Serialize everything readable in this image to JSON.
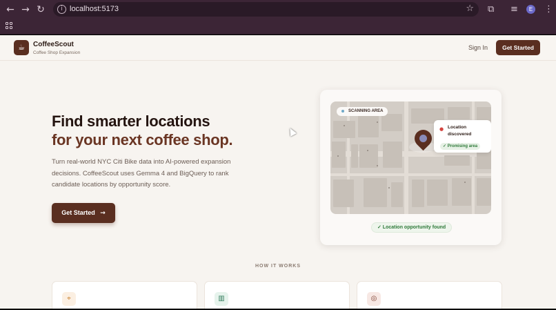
{
  "browser": {
    "url": "localhost:5173",
    "profile_initial": "E",
    "icons": {
      "back": "arrow-left-icon",
      "forward": "arrow-right-icon",
      "reload": "reload-icon",
      "info": "site-info-icon",
      "bookmark": "star-icon",
      "extensions": "puzzle-icon",
      "media": "media-controls-icon",
      "menu": "more-vert-icon",
      "apps": "apps-grid-icon"
    }
  },
  "header": {
    "brand": "CoffeeScout",
    "brand_sub": "Coffee Shop Expansion",
    "sign_in": "Sign In",
    "cta": "Get Started"
  },
  "hero": {
    "title_line1": "Find smarter locations",
    "title_line2": "for your next coffee shop.",
    "lead_lines": [
      "Turn real-world NYC Citi Bike data into AI-powered expansion",
      "decisions. CoffeeScout uses Gemma 4 and BigQuery to rank",
      "candidate locations by opportunity score."
    ],
    "cta": "Get Started",
    "cta_arrow": "→"
  },
  "map_card": {
    "scanning": "SCANNING AREA",
    "popup_title": "Location discovered",
    "popup_badge": "✓ Promising area",
    "found": "✓ Location opportunity found"
  },
  "how_it_works": {
    "heading": "HOW IT WORKS",
    "cards": [
      {
        "icon": "map-pin-icon",
        "color": "#c9812f",
        "bg": "#fbefe2",
        "glyph": "⌖"
      },
      {
        "icon": "bar-chart-icon",
        "color": "#2f7a5a",
        "bg": "#e6f3ec",
        "glyph": "▥"
      },
      {
        "icon": "brain-icon",
        "color": "#7a3a2a",
        "bg": "#f7e8e4",
        "glyph": "◎"
      }
    ]
  },
  "colors": {
    "brand": "#5a2e20",
    "accent_title": "#6a3523",
    "success": "#2f7a3a",
    "chrome": "#3c2536"
  }
}
